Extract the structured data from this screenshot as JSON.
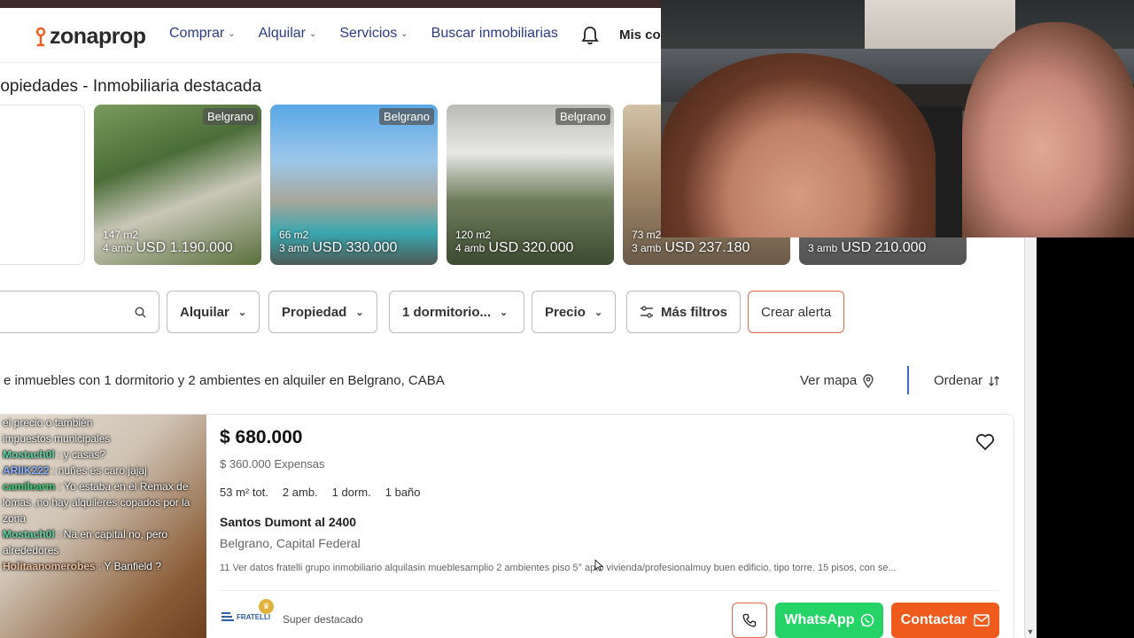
{
  "header": {
    "logo_text": "zonaprop",
    "nav": [
      {
        "label": "Comprar"
      },
      {
        "label": "Alquilar"
      },
      {
        "label": "Servicios"
      },
      {
        "label": "Buscar inmobiliarias"
      }
    ],
    "account_label": "Mis co"
  },
  "featured": {
    "title": "ropiedades - Inmobiliaria destacada",
    "cards": [
      {
        "badge": "Belgrano",
        "m2": "147 m2",
        "amb": "4 amb",
        "price": "USD 1.190.000"
      },
      {
        "badge": "Belgrano",
        "m2": "66 m2",
        "amb": "3 amb",
        "price": "USD 330.000"
      },
      {
        "badge": "Belgrano",
        "m2": "120 m2",
        "amb": "4 amb",
        "price": "USD 320.000"
      },
      {
        "badge": "",
        "m2": "73 m2",
        "amb": "3 amb",
        "price": "USD 237.180"
      },
      {
        "badge": "",
        "m2": "",
        "amb": "3 amb",
        "price": "USD 210.000"
      }
    ]
  },
  "filters": {
    "operation": "Alquilar",
    "property": "Propiedad",
    "rooms": "1 dormitorio...",
    "price": "Precio",
    "more": "Más filtros",
    "alert": "Crear alerta"
  },
  "results": {
    "title": "e inmuebles con 1 dormitorio y 2 ambientes en alquiler en Belgrano, CABA",
    "map_label": "Ver mapa",
    "sort_label": "Ordenar"
  },
  "listing": {
    "price": "$ 680.000",
    "expensas": "$ 360.000 Expensas",
    "features": [
      "53 m² tot.",
      "2 amb.",
      "1 dorm.",
      "1 baño"
    ],
    "address": "Santos Dumont al 2400",
    "location": "Belgrano, Capital Federal",
    "description": "11 Ver datos fratelli grupo inmobiliario alquilasin mueblesamplio 2 ambientes piso 5° apto vivienda/profesionalmuy buen edificio, tipo torre. 15 pisos, con se...",
    "agency": "FRATELLI",
    "tier": "Super destacado",
    "whatsapp_label": "WhatsApp",
    "contact_label": "Contactar"
  },
  "chat": [
    {
      "user": "",
      "msg": "el precio o también",
      "color": "#ffffff"
    },
    {
      "user": "",
      "msg": "impuestos municipales",
      "color": "#ffffff"
    },
    {
      "user": "Mostach0l",
      "msg": ": y casas?",
      "color": "#5fd4a6"
    },
    {
      "user": "ARIIK222",
      "msg": ": nuñes es caro jajaj",
      "color": "#8ab4ff"
    },
    {
      "user": "camilearm",
      "msg": ": Yo estaba en el Remax de lomas ,no hay alquileres copados por la zona",
      "color": "#3fd07a"
    },
    {
      "user": "Mostach0l",
      "msg": ": Na en capital no, pero alrededores",
      "color": "#5fd4a6"
    },
    {
      "user": "Holitaanomerobes",
      "msg": ": Y Banfield ?",
      "color": "#f0c2a0"
    }
  ],
  "colors": {
    "brand_orange": "#ef5a1d",
    "whatsapp_green": "#25d366",
    "nav_blue": "#2c3a8a"
  }
}
